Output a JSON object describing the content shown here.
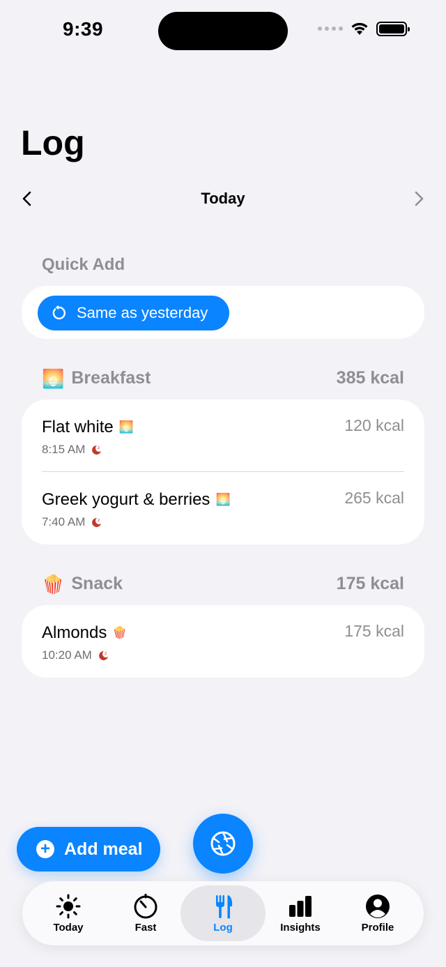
{
  "status": {
    "time": "9:39"
  },
  "header": {
    "title": "Log"
  },
  "date_nav": {
    "label": "Today"
  },
  "quick_add": {
    "label": "Quick Add",
    "button_label": "Same as yesterday"
  },
  "sections": [
    {
      "name": "Breakfast",
      "emoji": "🌅",
      "total": "385 kcal",
      "entries": [
        {
          "title": "Flat white",
          "emoji": "🌅",
          "time": "8:15 AM",
          "kcal": "120 kcal"
        },
        {
          "title": "Greek yogurt & berries",
          "emoji": "🌅",
          "time": "7:40 AM",
          "kcal": "265 kcal"
        }
      ]
    },
    {
      "name": "Snack",
      "emoji": "🍿",
      "total": "175 kcal",
      "entries": [
        {
          "title": "Almonds",
          "emoji": "🍿",
          "time": "10:20 AM",
          "kcal": "175 kcal"
        }
      ]
    }
  ],
  "actions": {
    "add_meal": "Add meal"
  },
  "tabs": [
    {
      "label": "Today",
      "icon": "sun-icon"
    },
    {
      "label": "Fast",
      "icon": "timer-icon"
    },
    {
      "label": "Log",
      "icon": "fork-knife-icon",
      "active": true
    },
    {
      "label": "Insights",
      "icon": "bar-chart-icon"
    },
    {
      "label": "Profile",
      "icon": "person-icon"
    }
  ],
  "colors": {
    "accent": "#0a84ff",
    "background": "#f2f2f7",
    "secondary_text": "#8e8e93",
    "moon_icon": "#c0392b"
  }
}
